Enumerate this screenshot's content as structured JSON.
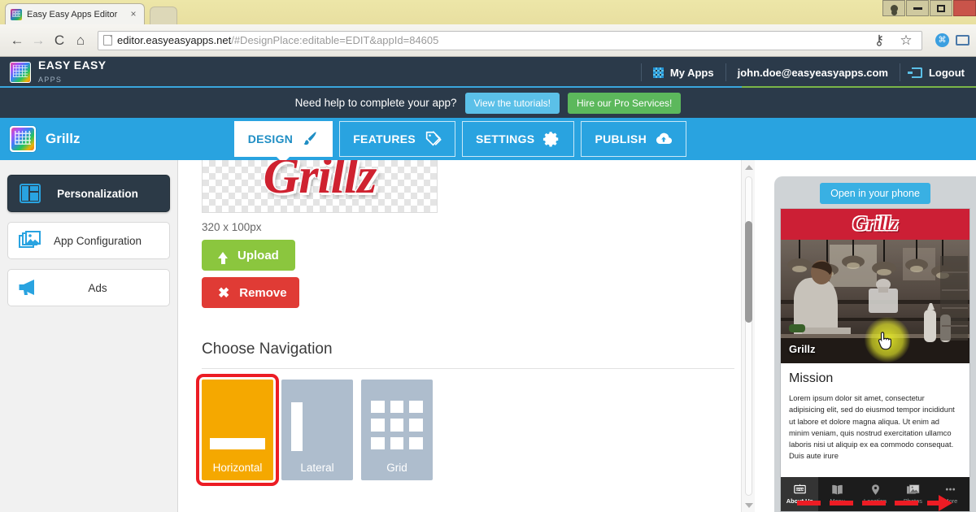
{
  "browser": {
    "tab_title": "Easy Easy Apps Editor",
    "tab_close": "×",
    "url_domain": "editor.easyeasyapps.net",
    "url_path": "/#DesignPlace:editable=EDIT&appId=84605",
    "back_glyph": "←",
    "forward_glyph": "→",
    "reload_glyph": "C",
    "home_glyph": "⌂",
    "key_glyph": "⚷",
    "star_glyph": "☆",
    "ext_glyph": "⌘"
  },
  "header": {
    "brand_line1": "EASY EASY",
    "brand_line2": "APPS",
    "my_apps": "My Apps",
    "account_email": "john.doe@easyeasyapps.com",
    "logout": "Logout"
  },
  "help_bar": {
    "message": "Need help to complete your app?",
    "tutorials_button": "View the tutorials!",
    "pro_button": "Hire our Pro Services!"
  },
  "app_nav": {
    "app_name": "Grillz",
    "tabs": [
      {
        "label": "DESIGN",
        "icon": "paintbrush-icon",
        "active": true
      },
      {
        "label": "FEATURES",
        "icon": "tags-icon",
        "active": false
      },
      {
        "label": "SETTINGS",
        "icon": "gear-icon",
        "active": false
      },
      {
        "label": "PUBLISH",
        "icon": "cloud-upload-icon",
        "active": false
      }
    ]
  },
  "sidebar": {
    "items": [
      {
        "label": "Personalization",
        "icon": "layout-icon",
        "active": true
      },
      {
        "label": "App Configuration",
        "icon": "images-icon",
        "active": false
      },
      {
        "label": "Ads",
        "icon": "megaphone-icon",
        "active": false
      }
    ]
  },
  "main": {
    "logo_text": "Grillz",
    "dimensions": "320 x 100px",
    "upload_button": "Upload",
    "remove_button": "Remove",
    "section_title": "Choose Navigation",
    "nav_options": [
      {
        "label": "Horizontal",
        "selected": true
      },
      {
        "label": "Lateral",
        "selected": false
      },
      {
        "label": "Grid",
        "selected": false
      }
    ]
  },
  "preview": {
    "open_button": "Open in your phone",
    "app_logo": "Grillz",
    "photo_caption": "Grillz",
    "heading": "Mission",
    "body": "Lorem ipsum dolor sit amet, consectetur adipisicing elit, sed do eiusmod tempor incididunt ut labore et dolore magna aliqua. Ut enim ad minim veniam, quis nostrud exercitation ullamco laboris nisi ut aliquip ex ea commodo consequat. Duis aute irure",
    "tabs": [
      {
        "label": "About Us",
        "icon": "open-sign-icon",
        "active": true
      },
      {
        "label": "Menu",
        "icon": "book-icon",
        "active": false
      },
      {
        "label": "Location",
        "icon": "map-pin-icon",
        "active": false
      },
      {
        "label": "Photos",
        "icon": "photos-icon",
        "active": false
      },
      {
        "label": "More",
        "icon": "ellipsis-icon",
        "active": false
      }
    ]
  },
  "colors": {
    "header_dark": "#2b3a4a",
    "app_blue": "#29a3e0",
    "accent_orange": "#f5a800",
    "highlight_red": "#ec1c24",
    "green": "#8bc63e",
    "red": "#e03b35",
    "brand_red": "#cc1f35"
  }
}
